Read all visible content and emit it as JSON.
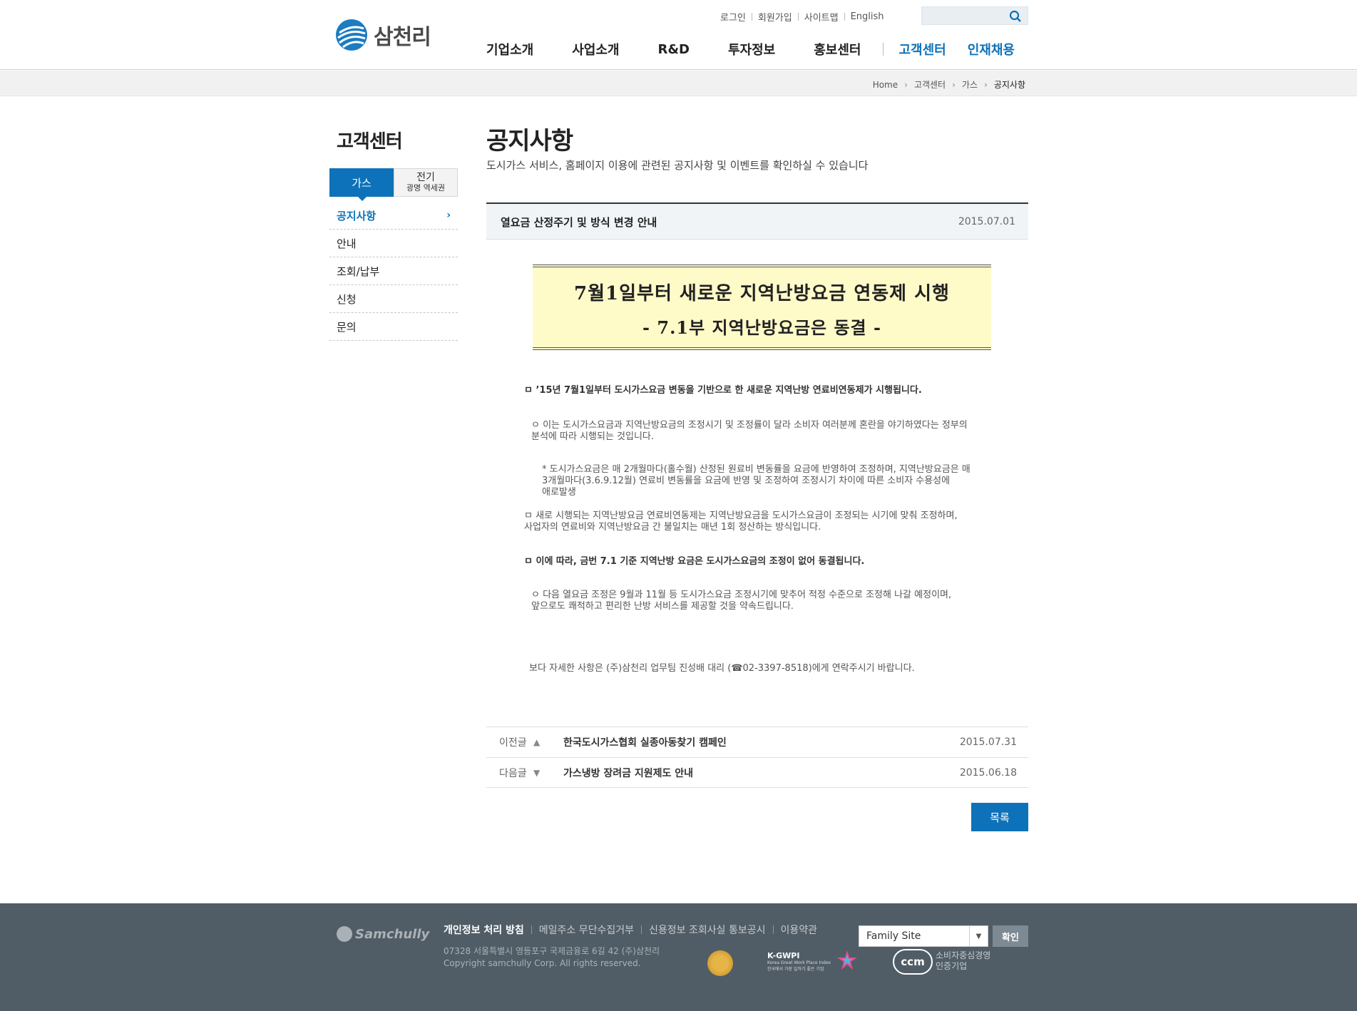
{
  "brand": {
    "name": "삼천리",
    "footer_logo": "Samchully"
  },
  "util": {
    "login": "로그인",
    "join": "회원가입",
    "sitemap": "사이트맵",
    "english": "English"
  },
  "search": {
    "placeholder": "",
    "icon": "search-icon"
  },
  "gnb": {
    "items": [
      "기업소개",
      "사업소개",
      "R&D",
      "투자정보",
      "홍보센터"
    ],
    "customer": "고객센터",
    "recruit": "인재채용"
  },
  "breadcrumb": [
    "Home",
    "고객센터",
    "가스",
    "공지사항"
  ],
  "side": {
    "title": "고객센터",
    "tabs": {
      "gas": "가스",
      "elec_l1": "전기",
      "elec_l2": "광명 역세권"
    },
    "menu": [
      "공지사항",
      "안내",
      "조회/납부",
      "신청",
      "문의"
    ]
  },
  "page": {
    "title": "공지사항",
    "desc": "도시가스 서비스, 홈페이지 이용에 관련된 공지사항 및 이벤트를 확인하실 수 있습니다"
  },
  "post": {
    "title": "열요금 산정주기 및 방식 변경 안내",
    "date": "2015.07.01",
    "banner_line1": "7월1일부터 새로운 지역난방요금 연동제 시행",
    "banner_line2": "- 7.1부 지역난방요금은 동결 -",
    "p1": "ㅁ ’15년 7월1일부터 도시가스요금 변동을 기반으로 한 새로운 지역난방 연료비연동제가 시행됩니다.",
    "p2a": "ㅇ 이는 도시가스요금과 지역난방요금의 조정시기 및 조정률이 달라 소비자 여러분께 혼란을 야기하였다는 정부의",
    "p2b": "분석에 따라 시행되는 것입니다.",
    "p3a": "* 도시가스요금은 매 2개월마다(홀수월) 산정된 원료비 변동률을 요금에 반영하여 조정하며, 지역난방요금은 매",
    "p3b": "3개월마다(3.6.9.12월) 연료비 변동률을 요금에 반영 및 조정하여 조정시기 차이에 따른 소비자 수용성에",
    "p3c": "애로발생",
    "p4a": "ㅁ 새로 시행되는 지역난방요금 연료비연동제는 지역난방요금을 도시가스요금이 조정되는 시기에 맞춰 조정하며,",
    "p4b": "사업자의 연료비와 지역난방요금 간 불일치는 매년 1회 정산하는 방식입니다.",
    "p5": "ㅁ 이에 따라, 금번 7.1 기준 지역난방 요금은 도시가스요금의 조정이 없어 동결됩니다.",
    "p6a": "ㅇ 다음 열요금 조정은 9월과 11월 등 도시가스요금 조정시기에 맞추어 적정 수준으로 조정해 나갈 예정이며,",
    "p6b": "앞으로도 쾌적하고 편리한 난방 서비스를 제공할 것을 약속드립니다.",
    "p7": "보다 자세한 사항은 (주)삼천리 업무팀 진성배 대리 (☎02-3397-8518)에게 연락주시기 바랍니다."
  },
  "nav": {
    "prev": {
      "label": "이전글",
      "title": "한국도시가스협회 실종아동찾기 캠페인",
      "date": "2015.07.31"
    },
    "next": {
      "label": "다음글",
      "title": "가스냉방 장려금 지원제도 안내",
      "date": "2015.06.18"
    }
  },
  "list_button": "목록",
  "footer": {
    "links": [
      "개인정보 처리 방침",
      "메일주소 무단수집거부",
      "신용정보 조회사실 통보공시",
      "이용약관"
    ],
    "addr1": "07328 서울특별시 영등포구 국제금융로 6길 42 (주)삼천리",
    "addr2": "Copyright samchully Corp. All rights reserved.",
    "kgwpi": "K-GWPI",
    "kgwpi_sub": "Korea Great Work Place Index",
    "kgwpi_sub2": "한국에서 가장 일하기 좋은 기업",
    "ccm": "ccm",
    "ccm_text1": "소비자중심경영",
    "ccm_text2": "인증기업",
    "family_site": "Family Site",
    "ok": "확인"
  },
  "colors": {
    "accent": "#0d72b9",
    "footer_bg": "#515d66",
    "banner_bg": "#fffbc9"
  }
}
